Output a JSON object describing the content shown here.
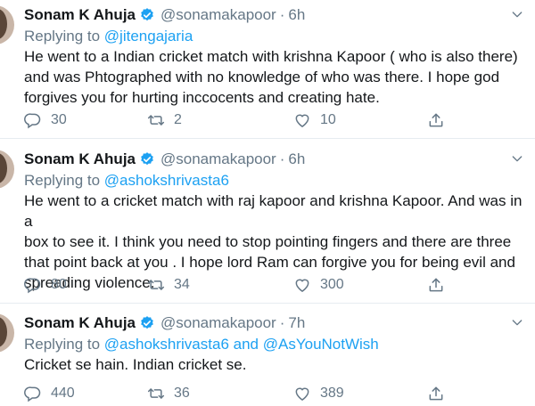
{
  "tweets": [
    {
      "name": "Sonam K Ahuja",
      "handle": "@sonamakapoor",
      "separator": "·",
      "time": "6h",
      "replying_prefix": "Replying to",
      "mentions": [
        "@jitengajaria"
      ],
      "mention_joiner": "",
      "text_lines": [
        "He went to a Indian cricket match with krishna Kapoor ( who is also there)",
        "and was Phtographed with no knowledge of who was there. I hope god",
        "forgives you for hurting inccocents and creating hate."
      ],
      "replies": "30",
      "retweets": "2",
      "likes": "10"
    },
    {
      "name": "Sonam K Ahuja",
      "handle": "@sonamakapoor",
      "separator": "·",
      "time": "6h",
      "replying_prefix": "Replying to",
      "mentions": [
        "@ashokshrivasta6"
      ],
      "mention_joiner": "",
      "text_lines": [
        "He went to a cricket match with raj kapoor and krishna Kapoor. And was in a",
        "box to see it. I think you need to stop pointing fingers and there are three",
        "that point back at you . I hope lord Ram can forgive you for being evil and",
        "spreading violence."
      ],
      "replies": "80",
      "retweets": "34",
      "likes": "300"
    },
    {
      "name": "Sonam K Ahuja",
      "handle": "@sonamakapoor",
      "separator": "·",
      "time": "7h",
      "replying_prefix": "Replying to",
      "mentions": [
        "@ashokshrivasta6",
        "@AsYouNotWish"
      ],
      "mention_joiner": "and",
      "text_lines": [
        "Cricket se hain. Indian cricket se."
      ],
      "replies": "440",
      "retweets": "36",
      "likes": "389"
    }
  ],
  "colors": {
    "link": "#1da1f2",
    "secondary_text": "#657786",
    "primary_text": "#14171a",
    "divider": "#e6ecf0",
    "verified_badge": "#1da1f2"
  },
  "icons": {
    "verified": "verified-badge-icon",
    "caret": "chevron-down-icon",
    "reply": "reply-icon",
    "retweet": "retweet-icon",
    "like": "heart-icon",
    "share": "share-icon"
  }
}
